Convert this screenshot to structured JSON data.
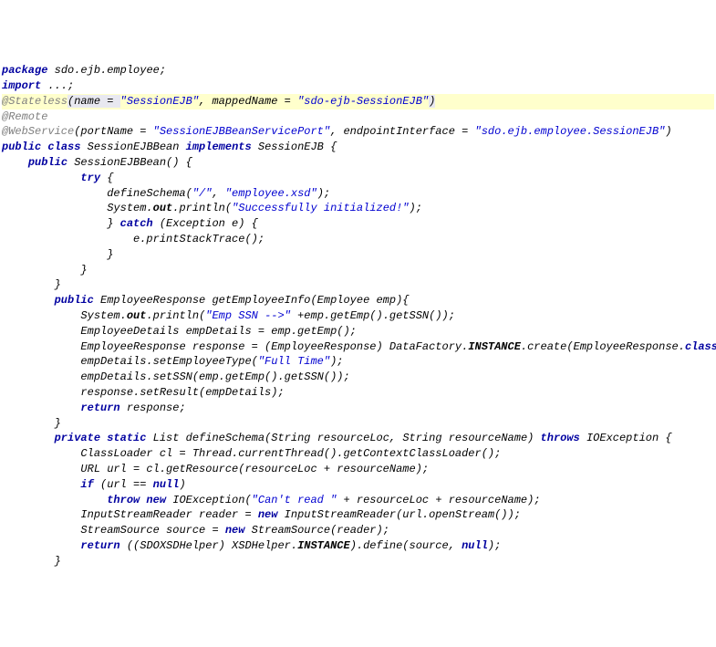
{
  "code": {
    "l1": {
      "kw1": "package",
      "pkg": " sdo.ejb.employee;"
    },
    "l2": "",
    "l3": {
      "kw1": "import",
      "rest": " ...;"
    },
    "l4": "",
    "l5": {
      "ann": "@Stateless",
      "p1": "(name = ",
      "s1": "\"SessionEJB\"",
      "p2": ", mappedName = ",
      "s2": "\"sdo-ejb-SessionEJB\"",
      "p3": ")"
    },
    "l6": {
      "ann": "@Remote"
    },
    "l7": {
      "ann": "@WebService",
      "p1": "(portName = ",
      "s1": "\"SessionEJBBeanServicePort\"",
      "p2": ", endpointInterface = ",
      "s2": "\"sdo.ejb.employee.SessionEJB\"",
      "p3": ")"
    },
    "l8": {
      "kw1": "public",
      "kw2": " class",
      "name": " SessionEJBBean ",
      "kw3": "implements",
      "rest": " SessionEJB {"
    },
    "l9": {
      "indent": "    ",
      "kw1": "public",
      "rest": " SessionEJBBean() {"
    },
    "l10": {
      "indent": "            ",
      "kw1": "try",
      "rest": " {"
    },
    "l11": {
      "indent": "                ",
      "fn": "defineSchema",
      "p1": "(",
      "s1": "\"/\"",
      "p2": ", ",
      "s2": "\"employee.xsd\"",
      "p3": ");"
    },
    "l12": {
      "indent": "                ",
      "cls": "System.",
      "fld": "out",
      "fn": ".println(",
      "s1": "\"Successfully initialized!\"",
      "p3": ");"
    },
    "l13": {
      "indent": "                ",
      "p1": "} ",
      "kw1": "catch",
      "rest": " (Exception e) {"
    },
    "l14": {
      "indent": "                    ",
      "rest": "e.printStackTrace();"
    },
    "l15": {
      "indent": "                ",
      "rest": "}"
    },
    "l16": {
      "indent": "            ",
      "rest": "}"
    },
    "l17": {
      "indent": "        ",
      "rest": "}"
    },
    "l18": {
      "indent": "        ",
      "kw1": "public",
      "rest1": " EmployeeResponse getEmployeeInfo(Employee emp){"
    },
    "l19": {
      "indent": "            ",
      "cls": "System.",
      "fld": "out",
      "fn": ".println(",
      "s1": "\"Emp SSN -->\"",
      "rest": " +emp.getEmp().getSSN());"
    },
    "l20": {
      "indent": "            ",
      "rest": "EmployeeDetails empDetails = emp.getEmp();"
    },
    "l21": {
      "indent": "            ",
      "p1": "EmployeeResponse response = (EmployeeResponse) DataFactory.",
      "fld": "INSTANCE",
      "p2": ".create(EmployeeResponse.",
      "kw1": "class",
      "p3": ");"
    },
    "l22": {
      "indent": "            ",
      "p1": "empDetails.setEmployeeType(",
      "s1": "\"Full Time\"",
      "p2": ");"
    },
    "l23": {
      "indent": "            ",
      "rest": "empDetails.setSSN(emp.getEmp().getSSN());"
    },
    "l24": {
      "indent": "            ",
      "rest": "response.setResult(empDetails);"
    },
    "l25": {
      "indent": "            ",
      "kw1": "return",
      "rest": " response;"
    },
    "l26": {
      "indent": "        ",
      "rest": "}"
    },
    "l27": "",
    "l28": {
      "indent": "        ",
      "kw1": "private",
      "kw2": " static",
      "rest1": " List ",
      "fn": "defineSchema",
      "rest2": "(String resourceLoc, String resourceName) ",
      "kw3": "throws",
      "rest3": " IOException {"
    },
    "l29": "",
    "l30": {
      "indent": "            ",
      "p1": "ClassLoader cl = Thread.",
      "stat": "currentThread",
      "rest": "().getContextClassLoader();"
    },
    "l31": {
      "indent": "            ",
      "rest": "URL url = cl.getResource(resourceLoc + resourceName);"
    },
    "l32": {
      "indent": "            ",
      "kw1": "if",
      "rest": " (url == ",
      "kw2": "null",
      "p3": ")"
    },
    "l33": {
      "indent": "                ",
      "kw1": "throw",
      "kw2": " new",
      "rest1": " IOException(",
      "s1": "\"Can't read \"",
      "rest2": " + resourceLoc + resourceName);"
    },
    "l34": "",
    "l35": {
      "indent": "            ",
      "p1": "InputStreamReader reader = ",
      "kw1": "new",
      "rest": " InputStreamReader(url.openStream());"
    },
    "l36": {
      "indent": "            ",
      "p1": "StreamSource source = ",
      "kw1": "new",
      "rest": " StreamSource(reader);"
    },
    "l37": {
      "indent": "            ",
      "kw1": "return",
      "p1": " ((SDOXSDHelper) XSDHelper.",
      "fld": "INSTANCE",
      "p2": ").define(source, ",
      "kw2": "null",
      "p3": ");"
    },
    "l38": {
      "indent": "        ",
      "rest": "}"
    }
  }
}
